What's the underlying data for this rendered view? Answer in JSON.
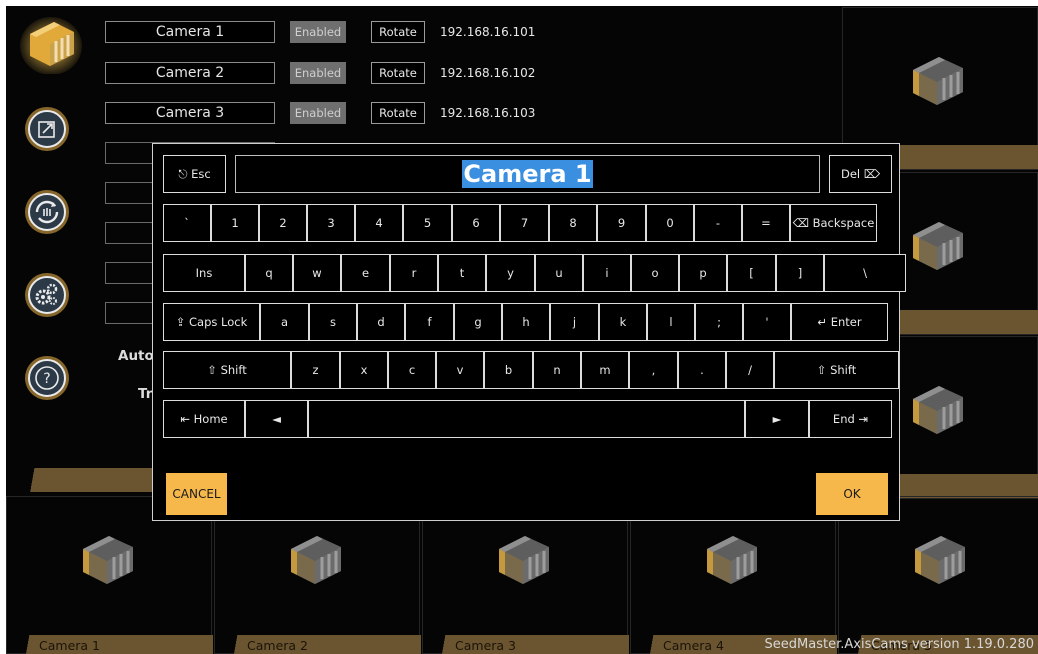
{
  "cameras": [
    {
      "name": "Camera 1",
      "enabled_label": "Enabled",
      "rotate_label": "Rotate",
      "ip": "192.168.16.101"
    },
    {
      "name": "Camera 2",
      "enabled_label": "Enabled",
      "rotate_label": "Rotate",
      "ip": "192.168.16.102"
    },
    {
      "name": "Camera 3",
      "enabled_label": "Enabled",
      "rotate_label": "Rotate",
      "ip": "192.168.16.103"
    }
  ],
  "settings_partial": {
    "auto_label": "Auto",
    "tr_label": "Tr"
  },
  "sidebar_icons": [
    "expand-icon",
    "refresh-icon",
    "settings-gears-icon",
    "help-icon"
  ],
  "tiles": {
    "bottom_labels": [
      "Camera 1",
      "Camera 2",
      "Camera 3",
      "Camera 4",
      "Camera 5"
    ]
  },
  "version": "SeedMaster.AxisCams version 1.19.0.280",
  "keyboard": {
    "text_value": "Camera 1",
    "esc_label": "⎋ Esc",
    "del_label": "Del ⌦",
    "row1": [
      "`",
      "1",
      "2",
      "3",
      "4",
      "5",
      "6",
      "7",
      "8",
      "9",
      "0",
      "-",
      "=",
      "⌫ Backspace"
    ],
    "row2": [
      "Ins",
      "q",
      "w",
      "e",
      "r",
      "t",
      "y",
      "u",
      "i",
      "o",
      "p",
      "[",
      "]",
      "\\"
    ],
    "row3": [
      "⇪ Caps Lock",
      "a",
      "s",
      "d",
      "f",
      "g",
      "h",
      "j",
      "k",
      "l",
      ";",
      "'",
      "↵ Enter"
    ],
    "row4": [
      "⇧ Shift",
      "z",
      "x",
      "c",
      "v",
      "b",
      "n",
      "m",
      ",",
      ".",
      "/",
      "⇧ Shift"
    ],
    "row5": [
      "⇤ Home",
      "◄",
      "",
      "►",
      "End ⇥"
    ],
    "cancel_label": "CANCEL",
    "ok_label": "OK"
  },
  "colors": {
    "accent": "#f7b84b",
    "band": "#6b5530",
    "selection": "#3a8fe0"
  }
}
